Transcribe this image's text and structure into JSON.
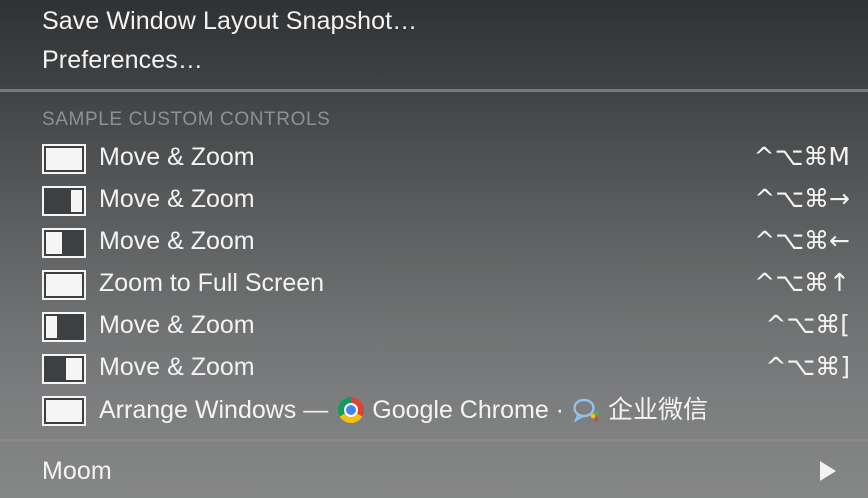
{
  "menu": {
    "save_snapshot": "Save Window Layout Snapshot…",
    "preferences": "Preferences…",
    "section_header": "SAMPLE CUSTOM CONTROLS",
    "controls": [
      {
        "label": "Move & Zoom",
        "shortcut": "^⌥⌘M",
        "thumb": "full"
      },
      {
        "label": "Move & Zoom",
        "shortcut": "^⌥⌘→",
        "thumb": "right"
      },
      {
        "label": "Move & Zoom",
        "shortcut": "^⌥⌘←",
        "thumb": "left"
      },
      {
        "label": "Zoom to Full Screen",
        "shortcut": "^⌥⌘↑",
        "thumb": "full"
      },
      {
        "label": "Move & Zoom",
        "shortcut": "^⌥⌘[",
        "thumb": "left-narrow"
      },
      {
        "label": "Move & Zoom",
        "shortcut": "^⌥⌘]",
        "thumb": "right-half"
      }
    ],
    "arrange": {
      "prefix": "Arrange Windows —",
      "app1": "Google Chrome ·",
      "app2": "企业微信",
      "app1_icon": "chrome-icon",
      "app2_icon": "wecom-icon"
    },
    "moom": "Moom",
    "submenu_icon": "submenu-arrow-icon"
  }
}
